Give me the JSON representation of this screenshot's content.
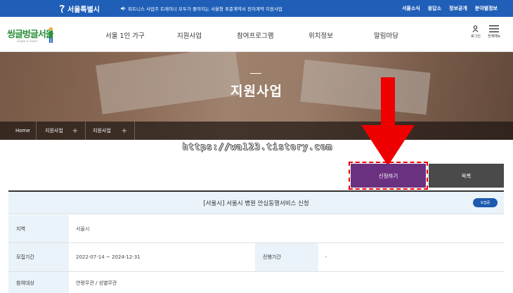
{
  "topbar": {
    "logo_text": "서울특별시",
    "notice_icon": "speaker-icon",
    "notice_text": "피트니스 사업주 트레이너 모두가 좋아지는 서울형 표준계약서 전자계약 지원사업",
    "links": [
      "서울소식",
      "응답소",
      "정보공개",
      "분야별정보"
    ]
  },
  "header": {
    "brand_text": "씽글벙글서울",
    "brand_sub": "Single & Seoul",
    "nav": [
      "서울 1인 가구",
      "지원사업",
      "참여프로그램",
      "위치정보",
      "알림마당"
    ],
    "login_label": "로그인",
    "menu_label": "전체메뉴"
  },
  "hero": {
    "title": "지원사업"
  },
  "breadcrumb": [
    {
      "label": "Home"
    },
    {
      "label": "지원사업"
    },
    {
      "label": "지원사업"
    }
  ],
  "watermark": "https://wa123.tistory.com",
  "actions": {
    "apply_label": "신청하기",
    "list_label": "목록"
  },
  "colors": {
    "accent_purple": "#6a3181",
    "brand_blue": "#1f5fb8",
    "highlight_red": "#e00000",
    "badge_blue": "#1d5ab0"
  },
  "info": {
    "title": "[서울시] 서울시 병원 안심동행서비스 신청",
    "status_badge": "모집중",
    "rows": [
      {
        "label": "지역",
        "value": "서울시"
      },
      {
        "label": "모집기간",
        "value": "2022-07-14 ~ 2024-12-31",
        "label2": "진행기간",
        "value2": "-"
      },
      {
        "label": "참여대상",
        "value": "연령무관 / 성별무관"
      }
    ]
  }
}
